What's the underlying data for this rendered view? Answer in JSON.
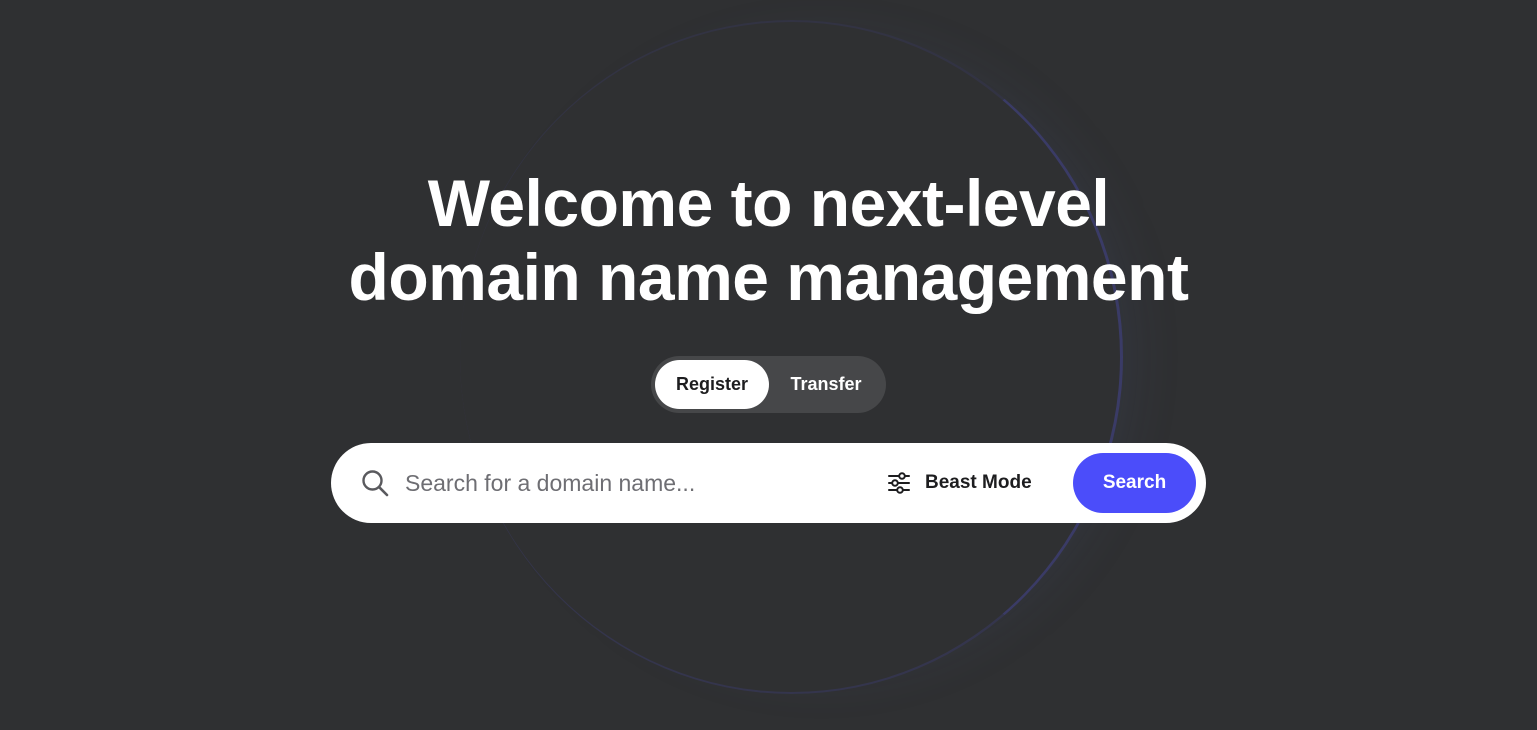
{
  "hero": {
    "headline_line1": "Welcome to next-level",
    "headline_line2": "domain name management"
  },
  "mode_toggle": {
    "options": [
      {
        "label": "Register",
        "active": true
      },
      {
        "label": "Transfer",
        "active": false
      }
    ]
  },
  "search": {
    "placeholder": "Search for a domain name...",
    "value": "",
    "beast_mode_label": "Beast Mode",
    "beast_mode_icon": "sliders-icon",
    "search_icon": "search-icon",
    "button_label": "Search"
  },
  "colors": {
    "background": "#2f3032",
    "accent": "#4b4dfa",
    "toggle_track": "#464749",
    "text_light": "#ffffff",
    "text_dark": "#1d1d1f"
  }
}
